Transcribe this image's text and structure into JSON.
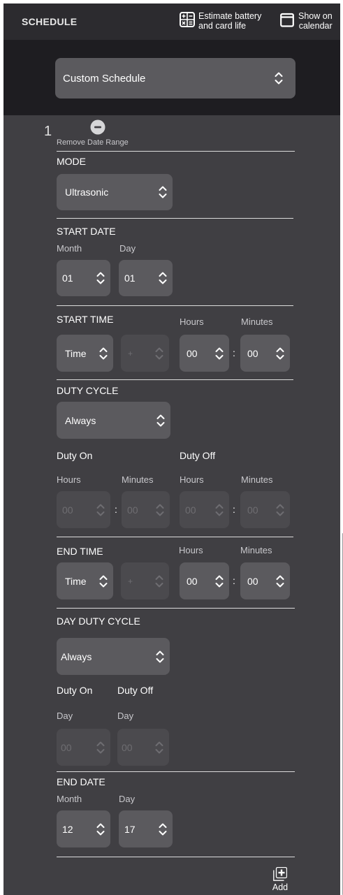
{
  "header": {
    "title": "SCHEDULE",
    "estimate_line1": "Estimate battery",
    "estimate_line2": "and card life",
    "calendar_line1": "Show on",
    "calendar_line2": "calendar"
  },
  "schedule_type": "Custom Schedule",
  "range": {
    "index": "1",
    "remove_label": "Remove Date Range",
    "mode": {
      "label": "MODE",
      "value": "Ultrasonic"
    },
    "start_date": {
      "label": "START DATE",
      "month_label": "Month",
      "day_label": "Day",
      "month": "01",
      "day": "01"
    },
    "start_time": {
      "label": "START TIME",
      "hours_label": "Hours",
      "minutes_label": "Minutes",
      "type": "Time",
      "offset": "+",
      "hours": "00",
      "minutes": "00",
      "sep": ":"
    },
    "duty_cycle": {
      "label": "DUTY CYCLE",
      "value": "Always",
      "on_label": "Duty On",
      "off_label": "Duty Off",
      "hours_label": "Hours",
      "minutes_label": "Minutes",
      "on_hours": "00",
      "on_minutes": "00",
      "off_hours": "00",
      "off_minutes": "00",
      "sep": ":"
    },
    "end_time": {
      "label": "END TIME",
      "hours_label": "Hours",
      "minutes_label": "Minutes",
      "type": "Time",
      "offset": "+",
      "hours": "00",
      "minutes": "00",
      "sep": ":"
    },
    "day_duty_cycle": {
      "label": "DAY DUTY CYCLE",
      "value": "Always",
      "on_label": "Duty On",
      "off_label": "Duty Off",
      "day_label": "Day",
      "on_day": "00",
      "off_day": "00"
    },
    "end_date": {
      "label": "END DATE",
      "month_label": "Month",
      "day_label": "Day",
      "month": "12",
      "day": "17"
    }
  },
  "add_label": "Add"
}
